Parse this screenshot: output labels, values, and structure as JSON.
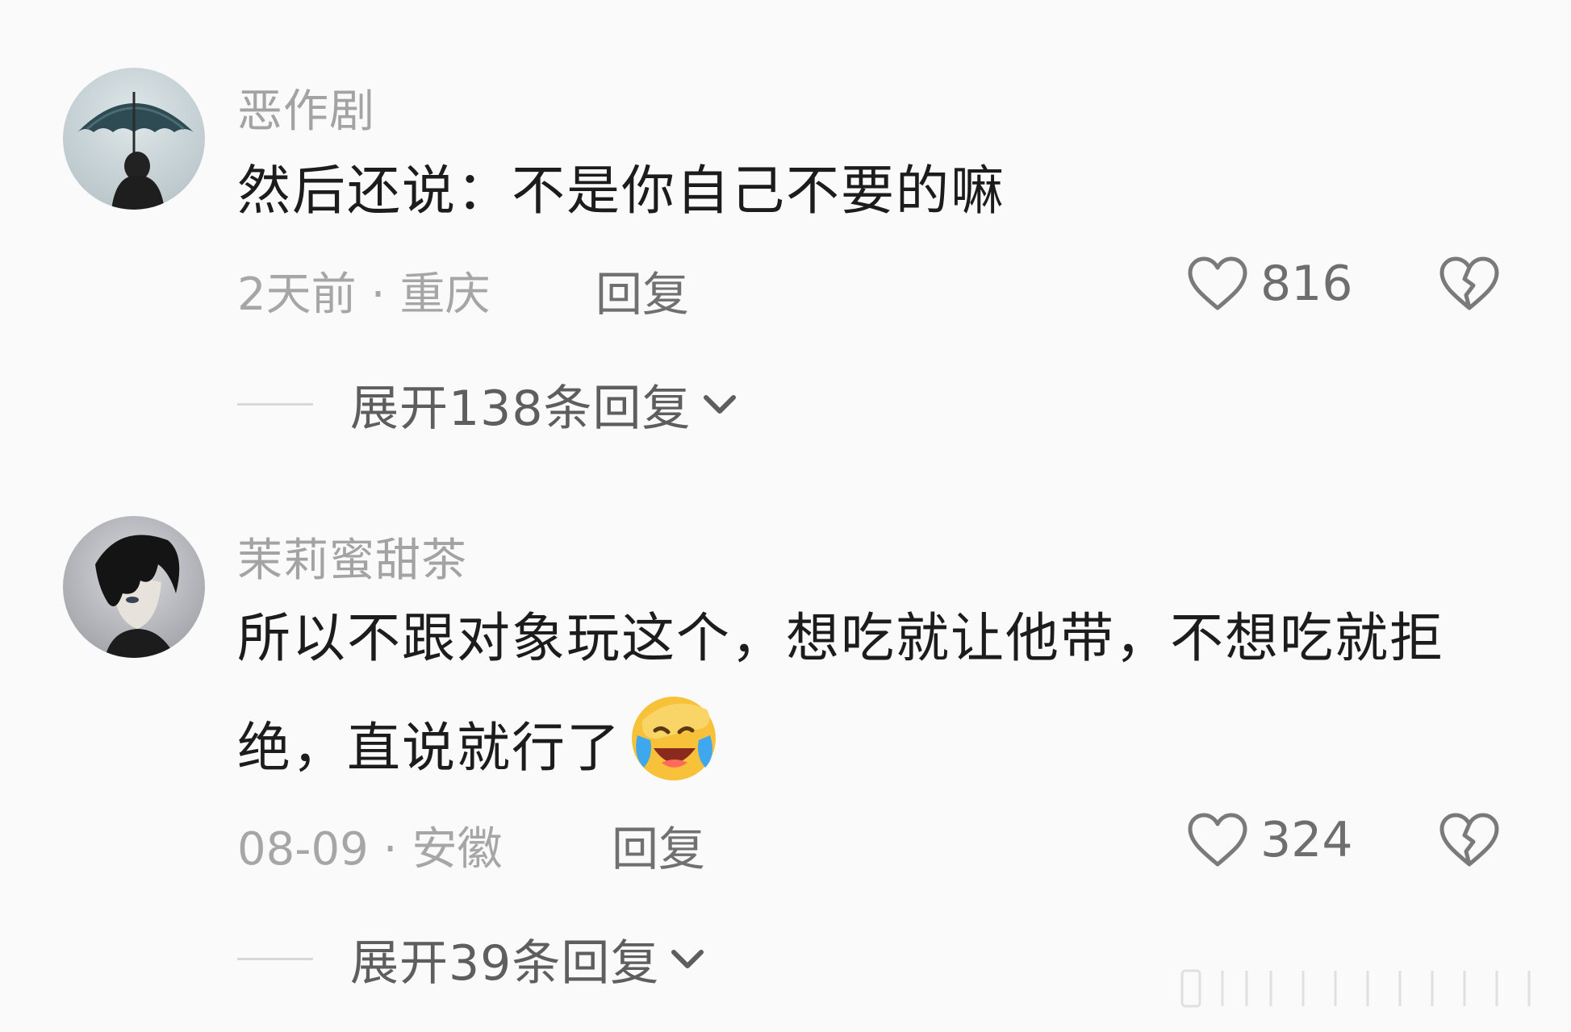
{
  "comments": [
    {
      "username": "恶作剧",
      "text": "然后还说：不是你自己不要的嘛",
      "time": "2天前",
      "separator": "·",
      "location": "重庆",
      "reply_label": "回复",
      "likes": "816",
      "expand_label": "展开138条回复",
      "avatar_icon": "avatar-umbrella",
      "emoji": null
    },
    {
      "username": "茉莉蜜甜茶",
      "text": "所以不跟对象玩这个，想吃就让他带，不想吃就拒绝，直说就行了",
      "time": "08-09",
      "separator": "·",
      "location": "安徽",
      "reply_label": "回复",
      "likes": "324",
      "expand_label": "展开39条回复",
      "avatar_icon": "avatar-anime-boy",
      "emoji": "laughing-crying-emoji"
    }
  ],
  "icons": {
    "like": "heart-outline-icon",
    "dislike": "broken-heart-icon",
    "expand": "chevron-down-icon"
  },
  "colors": {
    "background": "#fafafa",
    "username": "#a3a3a3",
    "text": "#1c1c1c",
    "meta": "#a6a6a6"
  }
}
